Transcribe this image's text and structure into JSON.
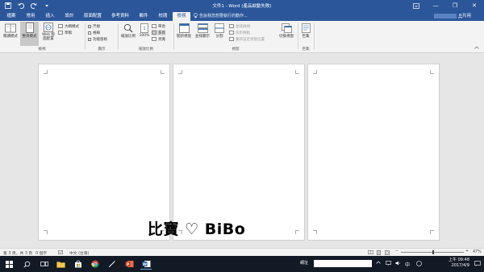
{
  "window": {
    "title": "文件1 - Word (產品啟動失敗)",
    "controls": {
      "minimize": "—",
      "restore": "❐",
      "close": "✕"
    }
  },
  "ribbon_tabs": [
    "檔案",
    "常用",
    "插入",
    "設計",
    "版面配置",
    "參考資料",
    "郵件",
    "校閱",
    "檢視"
  ],
  "tell_me": "告訴我您想要執行的動作...",
  "share_label": "共用",
  "ribbon": {
    "views": {
      "label": "檢視",
      "read_mode": "閱讀模式",
      "print_layout": "整頁模式",
      "web_layout": "Web 版面配置",
      "outline": "大綱模式",
      "draft": "草稿"
    },
    "show": {
      "label": "顯示",
      "ruler": "尺規",
      "gridlines": "格線",
      "nav_pane": "功能窗格"
    },
    "zoom": {
      "label": "縮放比例",
      "zoom": "縮放比例",
      "zoom_100": "100%",
      "one_page": "單頁",
      "multiple_pages": "多頁",
      "page_width": "頁寬"
    },
    "window": {
      "label": "視窗",
      "new_window": "開新視窗",
      "arrange_all": "並排顯示",
      "split": "分割",
      "side_by_side": "並排檢視",
      "sync_scroll": "同步捲動",
      "reset_position": "重新設定視窗位置",
      "switch_windows": "切換視窗"
    },
    "macros": {
      "label": "巨集",
      "macros": "巨集"
    }
  },
  "watermark": "比寶 ♡ BiBo",
  "status": {
    "page": "第 3 頁，共 3 頁",
    "words": "0 個字",
    "language": "中文 (台灣)",
    "zoom": "47%"
  },
  "taskbar": {
    "address_label": "網址",
    "time": "上午 09:48",
    "date": "2017/4/9",
    "ime": "中"
  },
  "colors": {
    "word_blue": "#2b579a",
    "ribbon_bg": "#f3f3f3",
    "taskbar_bg": "#121a26"
  }
}
